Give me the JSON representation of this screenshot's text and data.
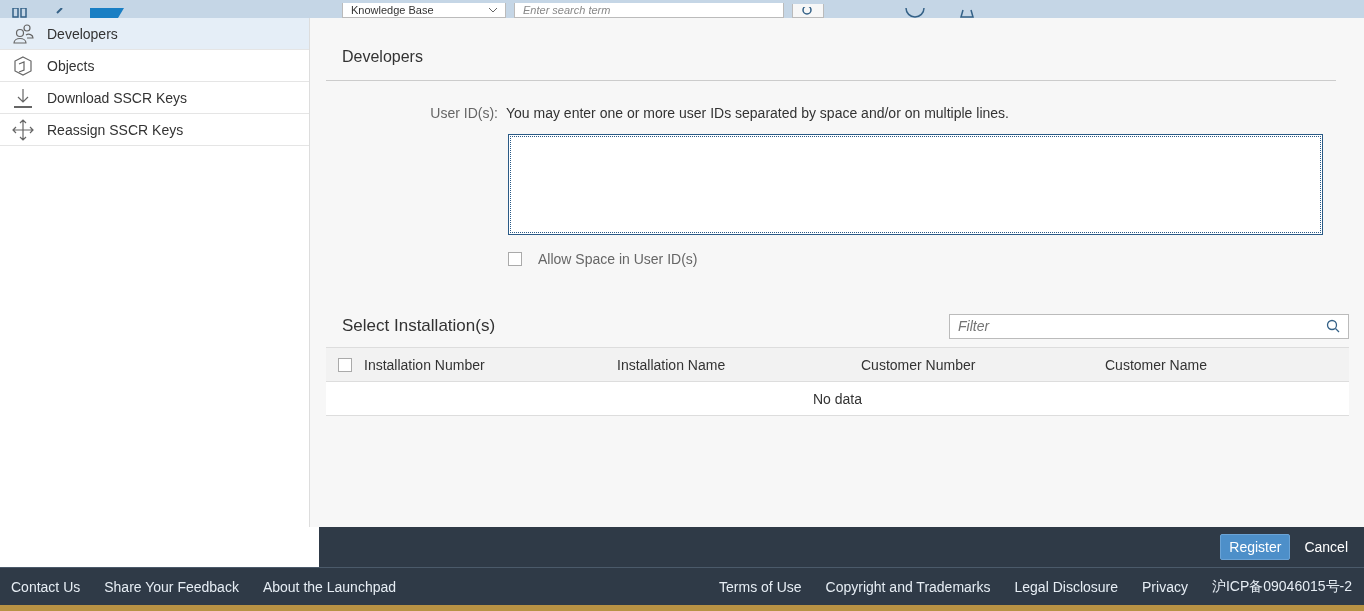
{
  "top_bar": {
    "source_select": {
      "value": "Knowledge Base"
    },
    "search": {
      "placeholder": "Enter search term"
    }
  },
  "sidebar": {
    "items": [
      {
        "label": "Developers",
        "kind": "people",
        "selected": true
      },
      {
        "label": "Objects",
        "kind": "cube",
        "selected": false
      },
      {
        "label": "Download SSCR Keys",
        "kind": "download",
        "selected": false
      },
      {
        "label": "Reassign SSCR Keys",
        "kind": "move",
        "selected": false
      }
    ]
  },
  "form": {
    "title": "Developers",
    "user_ids": {
      "label": "User ID(s):",
      "hint": "You may enter one or more user IDs separated by space and/or on multiple lines."
    },
    "allow_space": {
      "label": "Allow Space in User ID(s)",
      "checked": false
    }
  },
  "installations": {
    "title": "Select Installation(s)",
    "filter": {
      "placeholder": "Filter"
    },
    "select_all": {
      "checked": false
    },
    "columns": [
      "Installation Number",
      "Installation Name",
      "Customer Number",
      "Customer Name"
    ],
    "empty_text": "No data"
  },
  "actions": [
    {
      "label": "Register",
      "kind": "primary"
    },
    {
      "label": "Cancel",
      "kind": "plain"
    }
  ],
  "footer": {
    "left": [
      "Contact Us",
      "Share Your Feedback",
      "About the Launchpad"
    ],
    "right": [
      "Terms of Use",
      "Copyright and Trademarks",
      "Legal Disclosure",
      "Privacy",
      "沪ICP备09046015号-2"
    ]
  }
}
